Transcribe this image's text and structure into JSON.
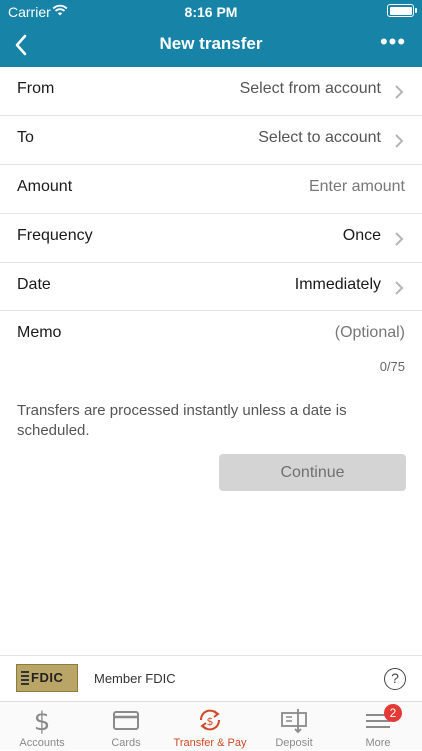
{
  "status_bar": {
    "carrier": "Carrier",
    "time": "8:16 PM"
  },
  "nav": {
    "title": "New transfer",
    "back_icon": "chevron-left-icon",
    "more_icon": "more-dots-icon"
  },
  "form": {
    "rows": [
      {
        "label": "From",
        "value": "Select from account"
      },
      {
        "label": "To",
        "value": "Select to account"
      },
      {
        "label": "Amount",
        "placeholder": "Enter amount"
      },
      {
        "label": "Frequency",
        "value": "Once"
      },
      {
        "label": "Date",
        "value": "Immediately"
      },
      {
        "label": "Memo",
        "placeholder": "(Optional)",
        "counter": "0/75"
      }
    ]
  },
  "note": "Transfers are processed instantly unless a date is scheduled.",
  "continue_label": "Continue",
  "fdic": {
    "logo_text": "FDIC",
    "member_text": "Member FDIC",
    "help_label": "?"
  },
  "tabs": [
    {
      "label": "Accounts",
      "icon": "dollar-icon"
    },
    {
      "label": "Cards",
      "icon": "card-icon"
    },
    {
      "label": "Transfer & Pay",
      "icon": "transfer-icon",
      "active": true
    },
    {
      "label": "Deposit",
      "icon": "check-deposit-icon"
    },
    {
      "label": "More",
      "icon": "menu-icon",
      "badge": "2"
    }
  ],
  "colors": {
    "header": "#1683a7",
    "active_tab": "#d04a25",
    "badge": "#e53935"
  }
}
